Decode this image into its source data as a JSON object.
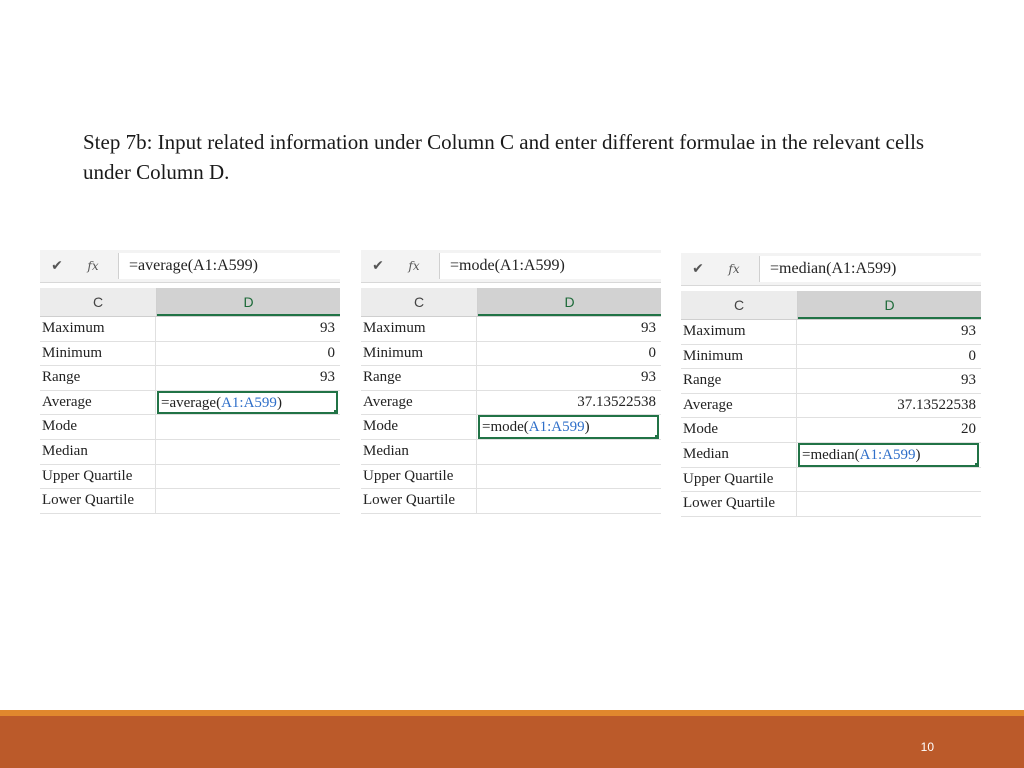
{
  "instruction": "Step 7b: Input related information under Column C and enter different formulae in the relevant cells under Column D.",
  "column_headers": {
    "c": "C",
    "d": "D"
  },
  "icons": {
    "check": "check-icon",
    "fx": "fx-icon"
  },
  "fx_label": "fx",
  "panels": [
    {
      "formula": "=average(A1:A599)",
      "active_prefix": "=average(",
      "active_ref": "A1:A599",
      "active_suffix": ")",
      "rows": [
        {
          "label": "Maximum",
          "value": "93"
        },
        {
          "label": "Minimum",
          "value": "0"
        },
        {
          "label": "Range",
          "value": "93"
        },
        {
          "label": "Average",
          "value": ""
        },
        {
          "label": "Mode",
          "value": ""
        },
        {
          "label": "Median",
          "value": ""
        },
        {
          "label": "Upper Quartile",
          "value": ""
        },
        {
          "label": "Lower Quartile",
          "value": ""
        }
      ]
    },
    {
      "formula": "=mode(A1:A599)",
      "active_prefix": "=mode(",
      "active_ref": "A1:A599",
      "active_suffix": ")",
      "rows": [
        {
          "label": "Maximum",
          "value": "93"
        },
        {
          "label": "Minimum",
          "value": "0"
        },
        {
          "label": "Range",
          "value": "93"
        },
        {
          "label": "Average",
          "value": "37.13522538"
        },
        {
          "label": "Mode",
          "value": ""
        },
        {
          "label": "Median",
          "value": ""
        },
        {
          "label": "Upper Quartile",
          "value": ""
        },
        {
          "label": "Lower Quartile",
          "value": ""
        }
      ]
    },
    {
      "formula": "=median(A1:A599)",
      "active_prefix": "=median(",
      "active_ref": "A1:A599",
      "active_suffix": ")",
      "rows": [
        {
          "label": "Maximum",
          "value": "93"
        },
        {
          "label": "Minimum",
          "value": "0"
        },
        {
          "label": "Range",
          "value": "93"
        },
        {
          "label": "Average",
          "value": "37.13522538"
        },
        {
          "label": "Mode",
          "value": "20"
        },
        {
          "label": "Median",
          "value": ""
        },
        {
          "label": "Upper Quartile",
          "value": ""
        },
        {
          "label": "Lower Quartile",
          "value": ""
        }
      ]
    }
  ],
  "page_number": "10",
  "colors": {
    "accent_green": "#217346",
    "ref_blue": "#2f6fc9",
    "footer": "#bb5a2a",
    "footer_stripe": "#e0872d"
  }
}
